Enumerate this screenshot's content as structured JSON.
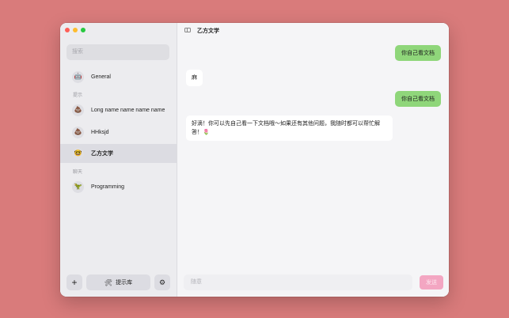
{
  "sidebar": {
    "search_placeholder": "搜索",
    "sections": {
      "prompts": "提示",
      "chats": "聊天"
    },
    "items": [
      {
        "label": "General",
        "icon": "🤖",
        "icon_name": "robot-icon"
      },
      {
        "label": "Long name name name name",
        "icon": "💩",
        "icon_name": "poop-icon"
      },
      {
        "label": "HHksjd",
        "icon": "💩",
        "icon_name": "poop-icon"
      },
      {
        "label": "乙方文学",
        "icon": "🤓",
        "icon_name": "nerd-face-icon",
        "active": true
      },
      {
        "label": "Programming",
        "icon": "🦖",
        "icon_name": "dinosaur-icon"
      }
    ],
    "buttons": {
      "add": "+",
      "prompt_library": "提示库",
      "prompt_library_icon": "🛠",
      "settings": "⚙"
    }
  },
  "chat": {
    "title": "乙方文学",
    "messages": [
      {
        "role": "user",
        "text": "你自己看文档"
      },
      {
        "role": "assistant",
        "text": "麻"
      },
      {
        "role": "user",
        "text": "你自己看文档"
      },
      {
        "role": "assistant",
        "text": "好滴！你可以先自己看一下文档哦～如果还有其他问题，我随时都可以帮忙解答！🌷"
      }
    ],
    "input_placeholder": "随意",
    "send_label": "发送"
  },
  "colors": {
    "desktop": "#d97b7b",
    "user_bubble": "#8fd67a",
    "send_button": "#f3a6c2"
  }
}
